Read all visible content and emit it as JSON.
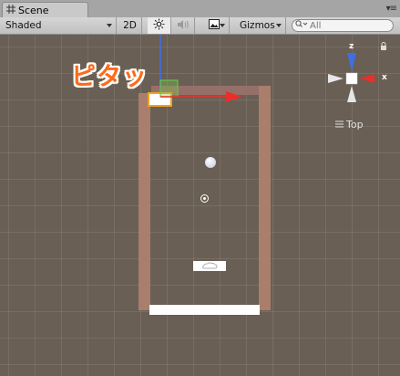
{
  "tab": {
    "title": "Scene",
    "icon": "scene-grid-icon"
  },
  "tab_menu_icon": "window-menu-icon",
  "toolbar": {
    "shading_mode": "Shaded",
    "mode_2d": "2D",
    "lighting_icon": "sun-icon",
    "audio_icon": "speaker-icon",
    "effects_icon": "image-icon",
    "gizmos": "Gizmos",
    "search_placeholder": "All"
  },
  "annotation": "ピタッ",
  "orientation_gizmo": {
    "y_label": "z",
    "x_label": "x",
    "view_label": "Top",
    "colors": {
      "x": "#e8302a",
      "z": "#3f6fe6",
      "center": "#ffffff"
    }
  },
  "colors": {
    "viewport_bg": "#6a5f54",
    "wall": "#a97e6c",
    "annotation": "#ff6a1a",
    "selection_outline": "#f0a020"
  }
}
